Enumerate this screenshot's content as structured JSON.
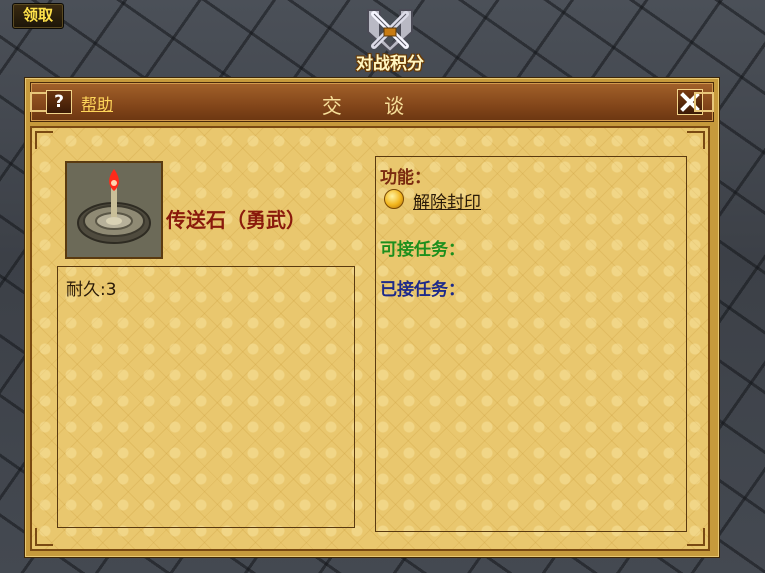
{
  "hud": {
    "claim_label": "领取",
    "battle_points_label": "对战积分"
  },
  "dialog": {
    "help_icon": "?",
    "help_label": "帮助",
    "title": "交 谈",
    "close_icon": "close-icon"
  },
  "item": {
    "name": "传送石（勇武）",
    "durability": "耐久:3"
  },
  "npc_panel": {
    "function_heading": "功能：",
    "function_action": "解除封印",
    "available_tasks": "可接任务：",
    "accepted_tasks": "已接任务："
  },
  "colors": {
    "title_text": "#f7df9a",
    "item_name": "#8a1a0c",
    "available_tasks": "#1d8f1d",
    "accepted_tasks": "#1d2a8a"
  }
}
